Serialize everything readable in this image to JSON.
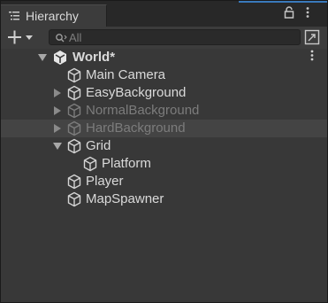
{
  "tab": {
    "title": "Hierarchy",
    "lock_icon": "lock-icon",
    "menu_icon": "kebab-menu-icon",
    "accent": "#3a79bb"
  },
  "toolbar": {
    "add_icon": "plus-icon",
    "search_placeholder": "All",
    "scene_button_icon": "scene-visibility-icon"
  },
  "scene": {
    "name": "World*",
    "more_icon": "kebab-menu-icon"
  },
  "items": [
    {
      "label": "Main Camera",
      "depth": 1,
      "expander": "none",
      "dim": false,
      "highlighted": false
    },
    {
      "label": "EasyBackground",
      "depth": 1,
      "expander": "collapsed",
      "dim": false,
      "highlighted": false
    },
    {
      "label": "NormalBackground",
      "depth": 1,
      "expander": "collapsed",
      "dim": true,
      "highlighted": false
    },
    {
      "label": "HardBackground",
      "depth": 1,
      "expander": "collapsed",
      "dim": true,
      "highlighted": true
    },
    {
      "label": "Grid",
      "depth": 1,
      "expander": "expanded",
      "dim": false,
      "highlighted": false
    },
    {
      "label": "Platform",
      "depth": 2,
      "expander": "none",
      "dim": false,
      "highlighted": false
    },
    {
      "label": "Player",
      "depth": 1,
      "expander": "none",
      "dim": false,
      "highlighted": false
    },
    {
      "label": "MapSpawner",
      "depth": 1,
      "expander": "none",
      "dim": false,
      "highlighted": false
    }
  ]
}
